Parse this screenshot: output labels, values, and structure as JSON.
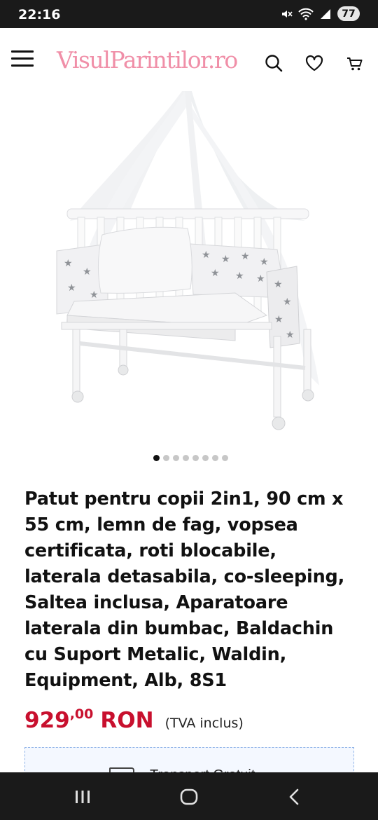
{
  "status_bar": {
    "time": "22:16",
    "battery": "77",
    "icons": [
      "mute-icon",
      "wifi-icon",
      "signal-icon",
      "battery-icon"
    ]
  },
  "header": {
    "logo": "VisulParintilor.ro",
    "logo_color": "#f08fa8",
    "icons": [
      "menu-icon",
      "search-icon",
      "heart-icon",
      "cart-icon"
    ]
  },
  "gallery": {
    "image": "crib-with-canopy-photo",
    "image_count": 8,
    "active_index": 0
  },
  "product": {
    "title": "Patut pentru copii 2in1, 90 cm x 55 cm, lemn de fag, vopsea certificata, roti blocabile, laterala detasabila, co-sleeping, Saltea inclusa, Aparatoare laterala din bumbac, Baldachin cu Suport Metalic, Waldin, Equipment, Alb, 8S1",
    "price_integer": "929",
    "price_decimal": ",00",
    "currency": "RON",
    "vat_note": "(TVA inclus)",
    "price_color": "#c8102e"
  },
  "delivery": {
    "label": "Transport Gratuit"
  },
  "nav_bar": {
    "icons": [
      "recents-icon",
      "home-icon",
      "back-icon"
    ]
  }
}
